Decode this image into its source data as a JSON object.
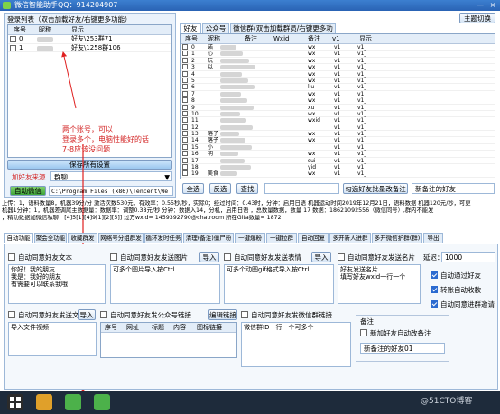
{
  "window": {
    "title": "微信智能助手QQ：914204907",
    "minimize": "—",
    "close": "×"
  },
  "login": {
    "group_title": "登录列表（双击加载好友/右键更多功能）",
    "columns": [
      "序号",
      "昵称",
      "显示"
    ],
    "rows": [
      {
        "num": "0",
        "display": "好友\\253群71"
      },
      {
        "num": "1",
        "display": "好友\\1258群106"
      }
    ]
  },
  "annotation": {
    "text": "两个账号，可以\n登录多个，电脑性能好的话\n7-8应该没问题",
    "color": "#e02020"
  },
  "left_controls": {
    "save_button": "保存所有设置",
    "source_label": "加好友来源",
    "source_value": "群聊",
    "auto_login_button": "自动微信",
    "path_value": "C:\\Program Files (x86)\\Tencent\\We"
  },
  "top_right": {
    "button": "主题切换"
  },
  "friend_tabs": [
    "好友",
    "公众号",
    "微信群(双击加载群员/右键更多功能)"
  ],
  "friend_grid": {
    "columns": [
      "序号",
      "昵称",
      "备注",
      "Wxid",
      "备注",
      "v1",
      "显示"
    ],
    "rows": [
      {
        "num": "0",
        "c4": "wx",
        "c6": "v1",
        "c7": "v1_"
      },
      {
        "num": "1",
        "c4": "wx",
        "c6": "v1",
        "c7": "v1_"
      },
      {
        "num": "2",
        "c4": "wx",
        "c6": "v1",
        "c7": "v1_"
      },
      {
        "num": "3",
        "c4": "wx",
        "c6": "v1",
        "c7": "v1_"
      },
      {
        "num": "4",
        "c4": "wx",
        "c6": "v1",
        "c7": "v1_"
      },
      {
        "num": "5",
        "c4": "wx",
        "c6": "v1",
        "c7": "v1_"
      },
      {
        "num": "6",
        "c4": "liu",
        "c6": "v1",
        "c7": "v1_"
      },
      {
        "num": "7",
        "c4": "wx",
        "c6": "v1",
        "c7": "v1_"
      },
      {
        "num": "8",
        "c4": "wx",
        "c6": "v1",
        "c7": "v1_"
      },
      {
        "num": "9",
        "c4": "xu",
        "c6": "v1",
        "c7": "v1_"
      },
      {
        "num": "10",
        "c4": "wx",
        "c6": "v1",
        "c7": "v1_"
      },
      {
        "num": "11",
        "c4": "wxid",
        "c6": "v1",
        "c7": "v1_"
      },
      {
        "num": "12",
        "c4": "",
        "c6": "v1",
        "c7": "v1_"
      },
      {
        "num": "13",
        "c4": "wx",
        "c6": "v1",
        "c7": "v1_"
      },
      {
        "num": "14",
        "c4": "wx",
        "c6": "v1",
        "c7": "v1_"
      },
      {
        "num": "15",
        "c4": "",
        "c6": "v1",
        "c7": "v1_"
      },
      {
        "num": "16",
        "c4": "wx",
        "c6": "v1",
        "c7": "v1_"
      },
      {
        "num": "17",
        "c4": "sui",
        "c6": "v1",
        "c7": "v1_"
      },
      {
        "num": "18",
        "c4": "yid",
        "c6": "v1",
        "c7": "v1_"
      },
      {
        "num": "19",
        "c4": "wx",
        "c6": "v1",
        "c7": "v1_"
      }
    ],
    "partial_names": [
      "诺",
      "心",
      "玩",
      "以",
      "",
      "",
      "",
      "",
      "",
      "",
      "",
      "",
      "",
      "落子",
      "落子",
      "小",
      "明",
      "",
      "",
      "美食"
    ]
  },
  "friend_buttons": {
    "select_all": "全选",
    "invert": "反选",
    "search": "查找",
    "remark_all": "勾选好友批量改备注",
    "remark_value": "新备注的好友"
  },
  "status_lines": [
    "上传：1，语料数量8，机器39分/分 激活次数530元，有效率：0.55秒/秒，实际0；经过时间：0.43时，分钟：启用日语 机器运动时间2019年12月21日，语料数据 机器120元/秒，可更",
    "机器1分钟：1，机器差调尾主数据量：数据率：调整0.38元/秒 分钟：数据入14，分机，启用日语 ，总数量数据，数量 17 数据：18621092556（微信同号）,群内不能发",
    "，精功数据加微信私聊：[4]5[1][4]9[1][2][5]] 过方wxid= 1459392790@chatroom 所在Gita数量= 1872"
  ],
  "func_tabs": [
    "自动功能",
    "聚会全功能",
    "收藏群发",
    "网络号分组群发",
    "循环发时任务",
    "清理(备注)僵尸粉",
    "一键爆粉",
    "一键拉群",
    "自动回复",
    "多开新人进群",
    "多开微信护群(群)",
    "导出"
  ],
  "sections": {
    "auto_friend_text": {
      "label": "自动同意好友文本",
      "value": "你好！我的朋友\n我是：我好的朋友\n有需要可以联系我哦"
    },
    "auto_friend_image": {
      "label": "自动同意好友发送图片",
      "import": "导入",
      "value": "可多个图片导入按Ctrl"
    },
    "auto_friend_gif": {
      "label": "自动同意好友发送表情",
      "import": "导入",
      "value": "可多个动图gif格式导入按Ctrl"
    },
    "auto_friend_card": {
      "label": "自动同意好友发送名片",
      "value": "好友发送名片\n填写好友wxid一行一个"
    },
    "delay_label": "延迟：",
    "delay_value": "1000",
    "auto_pass": "自动通过好友",
    "auto_collect": "转账自动收款",
    "auto_group_invite": "自动同意进群邀请",
    "auto_friend_file": {
      "label": "自动同意好友发送文件",
      "import": "导入",
      "value": "导入文件视频"
    },
    "auto_friend_mp": {
      "label": "自动同意好友发公众号链接",
      "edit": "编辑链接",
      "columns": [
        "序号",
        "网址",
        "标题",
        "内容",
        "图标链接"
      ]
    },
    "auto_friend_group": {
      "label": "自动同意好友发微信群链接",
      "value": "微信群ID一行一个可多个"
    },
    "remark": {
      "title": "备注",
      "label": "新加好友自动改备注",
      "value": "新备注的好友01"
    }
  },
  "taskbar": {
    "watermark": "@51CTO博客"
  },
  "colors": {
    "accent": "#2a63b4",
    "annotation": "#e02020",
    "panel": "#eaf2fb"
  }
}
